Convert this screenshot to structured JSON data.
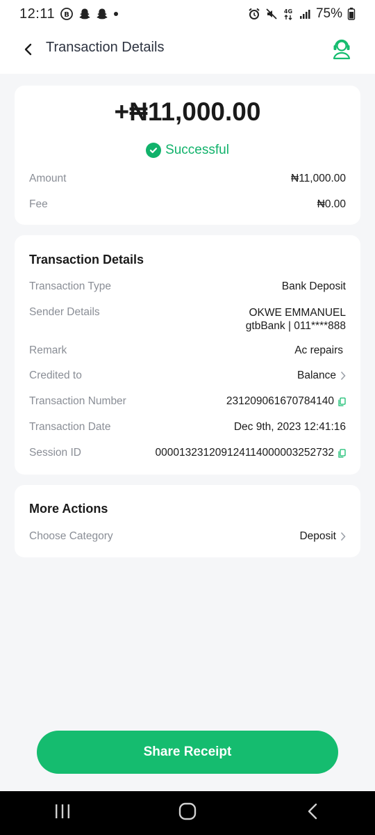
{
  "status_bar": {
    "time": "12:11",
    "network": "4G",
    "battery": "75%"
  },
  "header": {
    "title": "Transaction Details",
    "back_icon": "chevron-left-icon",
    "support_icon": "support-agent-icon"
  },
  "summary": {
    "amount": "+₦11,000.00",
    "status": "Successful",
    "rows": [
      {
        "label": "Amount",
        "value": "₦11,000.00"
      },
      {
        "label": "Fee",
        "value": "₦0.00"
      }
    ]
  },
  "details": {
    "title": "Transaction Details",
    "transaction_type": {
      "label": "Transaction Type",
      "value": "Bank Deposit"
    },
    "sender": {
      "label": "Sender Details",
      "name": "OKWE EMMANUEL",
      "bank": "gtbBank | 011****888"
    },
    "remark": {
      "label": "Remark",
      "value": "Ac repairs"
    },
    "credited_to": {
      "label": "Credited to",
      "value": "Balance"
    },
    "transaction_number": {
      "label": "Transaction Number",
      "value": "231209061670784140"
    },
    "transaction_date": {
      "label": "Transaction Date",
      "value": "Dec 9th, 2023 12:41:16"
    },
    "session_id": {
      "label": "Session ID",
      "value": "000013231209124114000003252732"
    }
  },
  "more_actions": {
    "title": "More Actions",
    "category": {
      "label": "Choose Category",
      "value": "Deposit"
    }
  },
  "share_button": {
    "label": "Share Receipt"
  },
  "colors": {
    "accent": "#15bc6f",
    "success": "#11b26b",
    "background": "#f5f6f8",
    "muted_text": "#8a8e96"
  }
}
